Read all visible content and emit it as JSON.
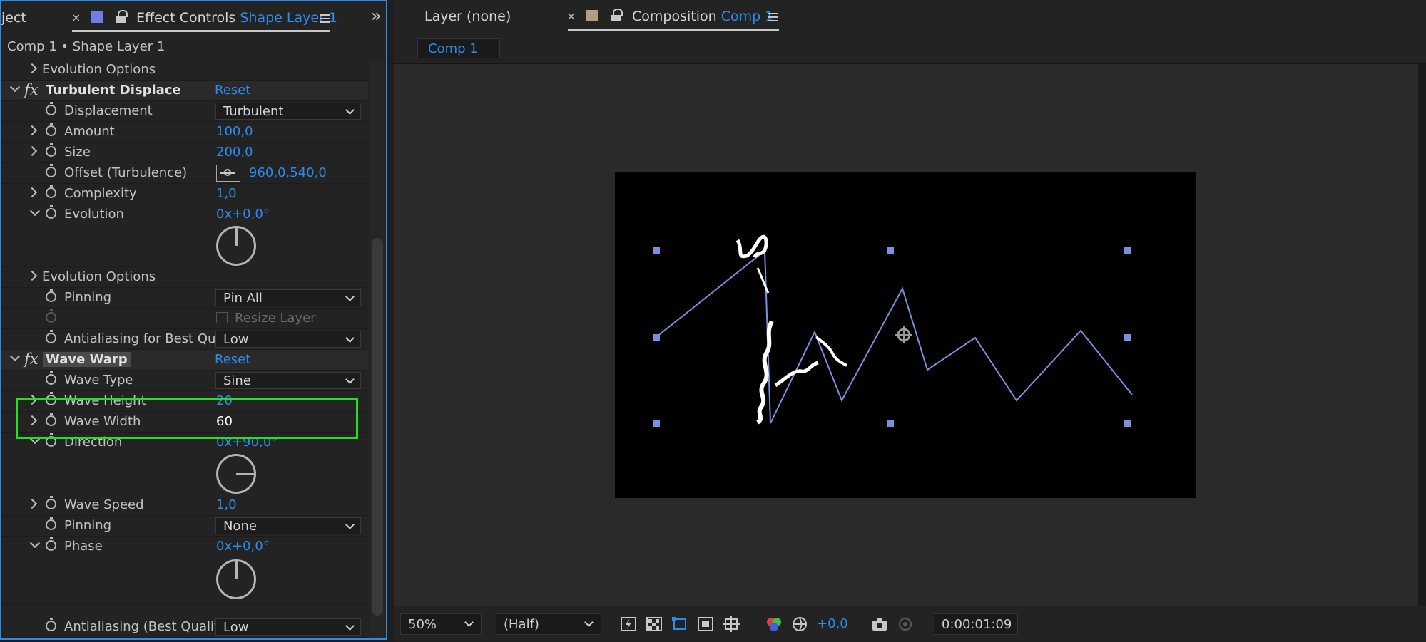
{
  "left_panel": {
    "tab_project_partial": "ject",
    "tab_effect_controls": "Effect Controls",
    "tab_effect_controls_layer": "Shape Layer 1",
    "breadcrumb": "Comp 1 • Shape Layer 1",
    "rows": {
      "evolution_options_1": "Evolution Options",
      "turbulent_displace": "Turbulent Displace",
      "turbulent_reset": "Reset",
      "displacement": "Displacement",
      "displacement_value": "Turbulent",
      "amount": "Amount",
      "amount_value": "100,0",
      "size": "Size",
      "size_value": "200,0",
      "offset": "Offset (Turbulence)",
      "offset_value": "960,0,540,0",
      "complexity": "Complexity",
      "complexity_value": "1,0",
      "evolution": "Evolution",
      "evolution_value": "0x+0,0°",
      "evolution_options_2": "Evolution Options",
      "pinning_1": "Pinning",
      "pinning_1_value": "Pin All",
      "resize_layer": "Resize Layer",
      "antialiasing_1": "Antialiasing for Best Qua",
      "antialiasing_1_value": "Low",
      "wave_warp": "Wave Warp",
      "wave_warp_reset": "Reset",
      "wave_type": "Wave Type",
      "wave_type_value": "Sine",
      "wave_height": "Wave Height",
      "wave_height_value": "20",
      "wave_width": "Wave Width",
      "wave_width_value": "60",
      "direction": "Direction",
      "direction_value": "0x+90,0°",
      "wave_speed": "Wave Speed",
      "wave_speed_value": "1,0",
      "pinning_2": "Pinning",
      "pinning_2_value": "None",
      "phase": "Phase",
      "phase_value": "0x+0,0°",
      "antialiasing_2": "Antialiasing (Best Qualit",
      "antialiasing_2_value": "Low"
    }
  },
  "right_panel": {
    "tab_layer": "Layer (none)",
    "tab_composition": "Composition",
    "tab_composition_name": "Comp 1",
    "comp_button": "Comp 1",
    "footer": {
      "zoom": "50%",
      "resolution": "(Half)",
      "exposure": "+0,0",
      "timecode": "0:00:01:09"
    }
  },
  "colors": {
    "accent": "#2d8ceb",
    "highlight_box": "#22e022",
    "path_stroke": "#7b8fe0",
    "panel_bg": "#232323"
  }
}
